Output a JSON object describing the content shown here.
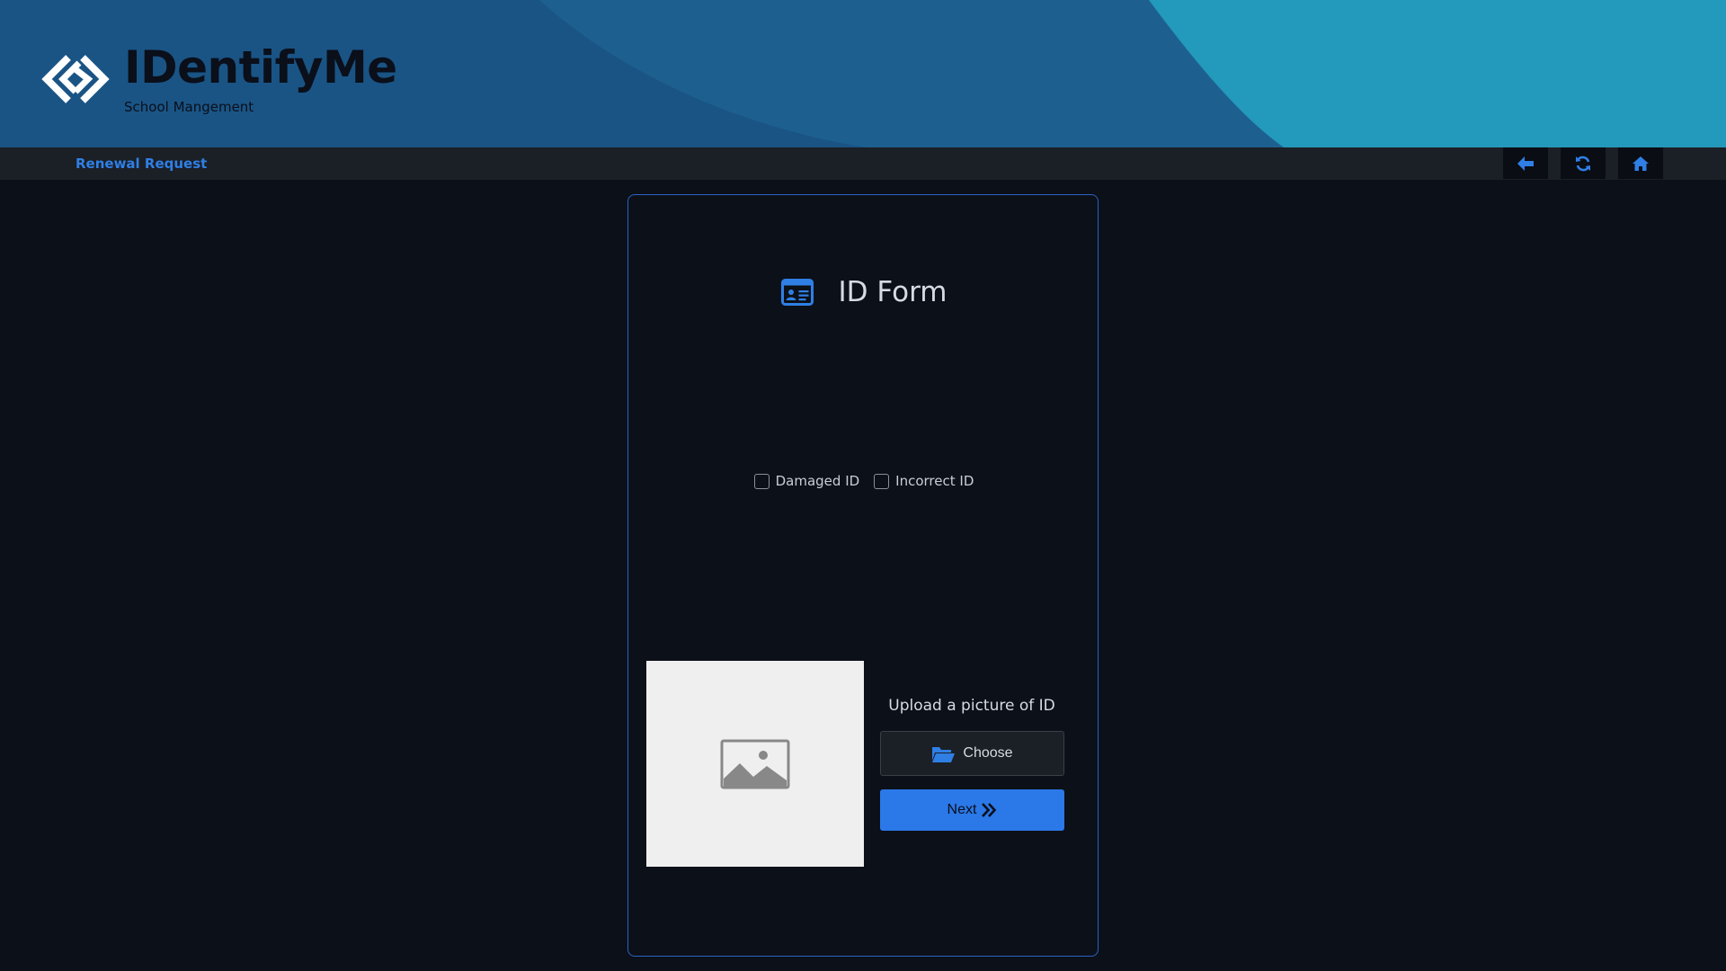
{
  "brand": {
    "name": "IDentifyMe",
    "subtitle": "School Mangement"
  },
  "navbar": {
    "breadcrumb": "Renewal Request",
    "buttons": [
      {
        "icon": "arrow-left-icon",
        "action": "back"
      },
      {
        "icon": "refresh-icon",
        "action": "refresh"
      },
      {
        "icon": "home-icon",
        "action": "home"
      }
    ]
  },
  "form": {
    "title": "ID Form",
    "title_icon": "id-card-icon",
    "options": [
      {
        "label": "Damaged ID",
        "checked": false
      },
      {
        "label": "Incorrect ID",
        "checked": false
      }
    ],
    "image_placeholder_icon": "image-icon",
    "upload_label": "Upload a picture of ID",
    "choose_label": "Choose",
    "choose_icon": "folder-open-icon",
    "next_label": "Next",
    "next_icon": "double-chevron-right-icon"
  },
  "colors": {
    "accent": "#2b78e8",
    "link": "#2f7fe5",
    "background": "#0c1018",
    "header_dark": "#1a5485",
    "header_light": "#2399bb",
    "card_border": "#2a63c4"
  }
}
